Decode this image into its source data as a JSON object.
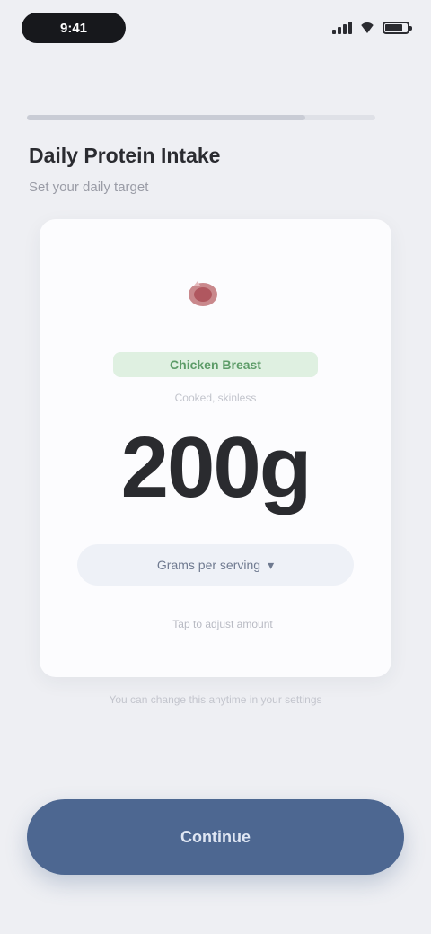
{
  "status_bar": {
    "time": "9:41"
  },
  "progress": {
    "value": 0.8
  },
  "header": {
    "title": "Daily Protein Intake",
    "subtitle": "Set your daily target"
  },
  "card": {
    "icon": "meat-icon",
    "food_tag": "Chicken Breast",
    "food_caption": "Cooked, skinless",
    "amount": "200g",
    "unit_select": "Grams per serving",
    "note": "Tap to adjust amount"
  },
  "footnote": "You can change this anytime in your settings",
  "button": {
    "label": "Continue"
  },
  "colors": {
    "background": "#eeeff3",
    "accent": "#4d6791",
    "tag_bg": "#dff0e1",
    "tag_text": "#5d9c68"
  }
}
